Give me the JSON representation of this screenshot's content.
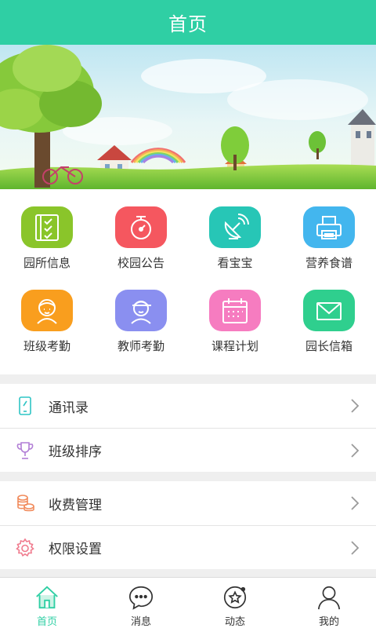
{
  "header": {
    "title": "首页"
  },
  "grid": [
    {
      "label": "园所信息",
      "icon": "checklist-icon",
      "color": "#8ac52a"
    },
    {
      "label": "校园公告",
      "icon": "alarm-clock-icon",
      "color": "#f5575f"
    },
    {
      "label": "看宝宝",
      "icon": "satellite-dish-icon",
      "color": "#27c6b6"
    },
    {
      "label": "营养食谱",
      "icon": "printer-icon",
      "color": "#43b6ee"
    },
    {
      "label": "班级考勤",
      "icon": "girl-avatar-icon",
      "color": "#f99e1e"
    },
    {
      "label": "教师考勤",
      "icon": "boy-avatar-icon",
      "color": "#8a8ff0"
    },
    {
      "label": "课程计划",
      "icon": "calendar-icon",
      "color": "#f67cc0"
    },
    {
      "label": "园长信箱",
      "icon": "envelope-icon",
      "color": "#2fcf8e"
    }
  ],
  "list_group_1": [
    {
      "label": "通讯录",
      "icon": "phone-icon",
      "color": "#2fc5c5"
    },
    {
      "label": "班级排序",
      "icon": "trophy-icon",
      "color": "#b27fd6"
    }
  ],
  "list_group_2": [
    {
      "label": "收费管理",
      "icon": "coins-icon",
      "color": "#f18b5c"
    },
    {
      "label": "权限设置",
      "icon": "gear-icon",
      "color": "#f07b8e"
    }
  ],
  "tabbar": [
    {
      "label": "首页",
      "icon": "home-icon",
      "active": true
    },
    {
      "label": "消息",
      "icon": "chat-bubble-icon",
      "active": false
    },
    {
      "label": "动态",
      "icon": "star-compass-icon",
      "active": false
    },
    {
      "label": "我的",
      "icon": "person-icon",
      "active": false
    }
  ],
  "colors": {
    "accent": "#2fcfa4",
    "background": "#efefef"
  }
}
